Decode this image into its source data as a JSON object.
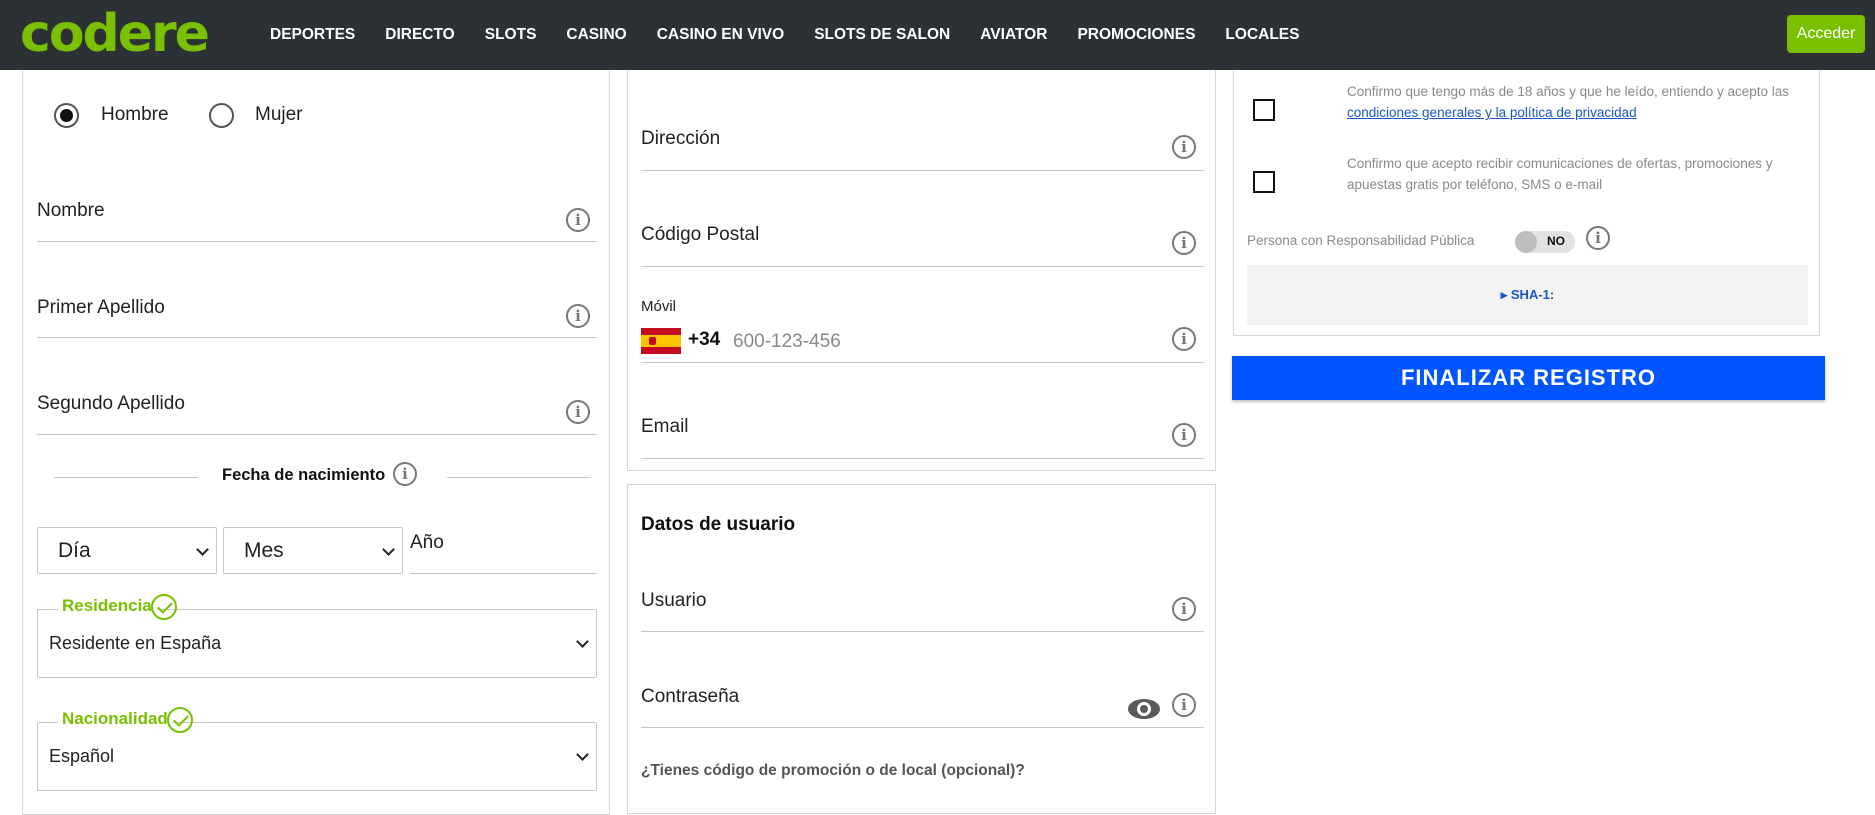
{
  "header": {
    "logo": "codere",
    "nav": [
      "DEPORTES",
      "DIRECTO",
      "SLOTS",
      "CASINO",
      "CASINO EN VIVO",
      "SLOTS DE SALON",
      "AVIATOR",
      "PROMOCIONES",
      "LOCALES"
    ],
    "login_label": "Acceder"
  },
  "personal": {
    "gender_options": [
      "Hombre",
      "Mujer"
    ],
    "gender_selected": "Hombre",
    "nombre_label": "Nombre",
    "primer_apellido_label": "Primer Apellido",
    "segundo_apellido_label": "Segundo Apellido",
    "birthdate_label": "Fecha de nacimiento",
    "day_select": "Día",
    "month_select": "Mes",
    "year_label": "Año",
    "residencia_label": "Residencia",
    "residencia_value": "Residente en España",
    "nacionalidad_label": "Nacionalidad",
    "nacionalidad_value": "Español"
  },
  "contact": {
    "direccion_label": "Dirección",
    "codigo_postal_label": "Código Postal",
    "movil_label": "Móvil",
    "phone_prefix": "+34",
    "phone_placeholder": "600-123-456",
    "email_label": "Email"
  },
  "user": {
    "section_title": "Datos de usuario",
    "usuario_label": "Usuario",
    "password_label": "Contraseña",
    "promo_question": "¿Tienes código de promoción o de local (opcional)?"
  },
  "terms": {
    "age_text": "Confirmo que tengo más de 18 años y que he leído, entiendo y acepto las",
    "age_link": "condiciones generales y la política de privacidad",
    "comms_text": "Confirmo que acepto recibir comunicaciones de ofertas, promociones y apuestas gratis por teléfono, SMS o e-mail",
    "pep_label": "Persona con Responsabilidad Pública",
    "pep_toggle": "NO",
    "sha_label": "▸ SHA-1:"
  },
  "finalize_label": "FINALIZAR REGISTRO",
  "colors": {
    "brand_green": "#79c000",
    "header_bg": "#2b3135",
    "primary_blue": "#0055ff"
  },
  "icons": [
    "info-icon",
    "eye-icon",
    "check-circle-icon",
    "chevron-down-icon",
    "spain-flag-icon"
  ]
}
